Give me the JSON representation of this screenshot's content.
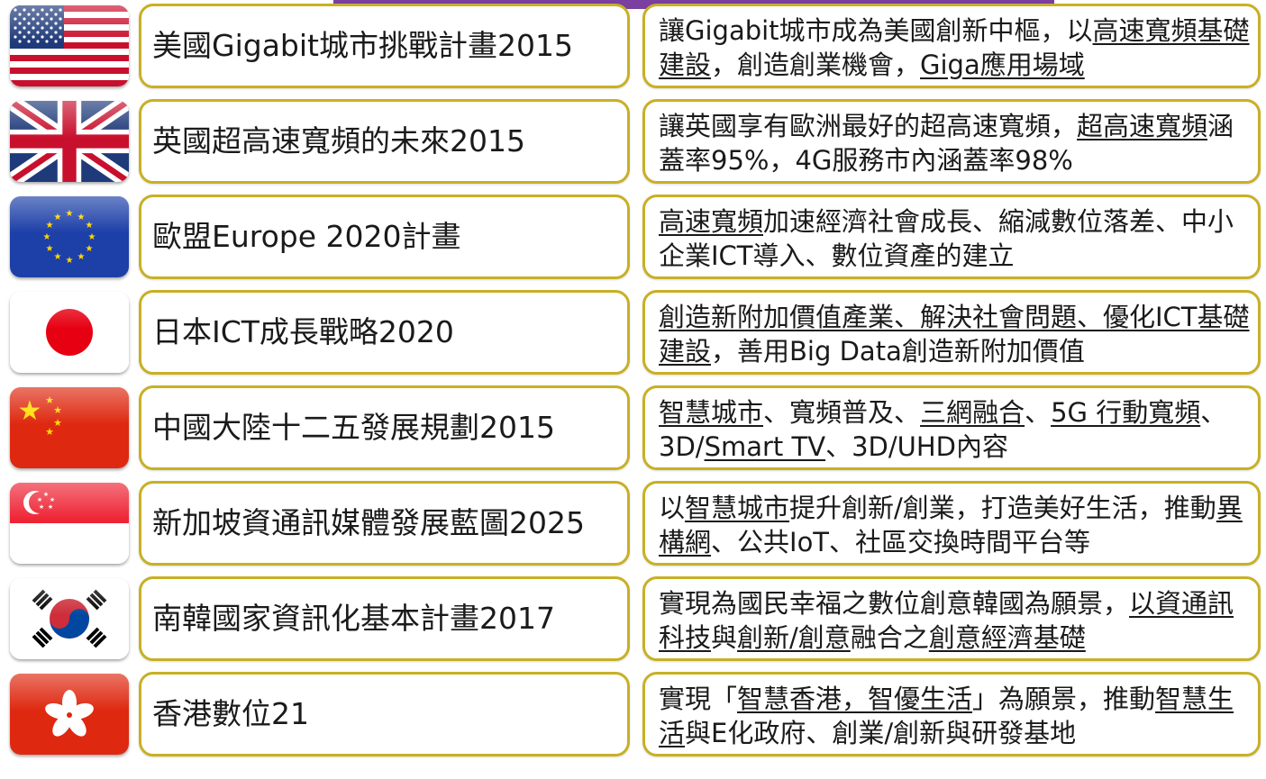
{
  "rows": [
    {
      "flag": "flag-usa",
      "name": "美國Gigabit城市挑戰計畫2015",
      "desc": [
        {
          "t": "讓Gigabit城市成為美國創新中樞，以",
          "u": false
        },
        {
          "t": "高速寬頻基礎建設",
          "u": true
        },
        {
          "t": "，創造創業機會，",
          "u": false
        },
        {
          "t": "Giga應用場域",
          "u": true
        }
      ]
    },
    {
      "flag": "flag-uk",
      "name": "英國超高速寬頻的未來2015",
      "desc": [
        {
          "t": "讓英國享有歐洲最好的超高速寬頻，",
          "u": false
        },
        {
          "t": "超高速寬頻",
          "u": true
        },
        {
          "t": "涵蓋率95%，4G服務市內涵蓋率98%",
          "u": false
        }
      ]
    },
    {
      "flag": "flag-eu",
      "name": "歐盟Europe 2020計畫",
      "desc": [
        {
          "t": "高速寬頻",
          "u": true
        },
        {
          "t": "加速經濟社會成長、縮減數位落差、中小企業ICT導入、數位資產的建立",
          "u": false
        }
      ]
    },
    {
      "flag": "flag-japan",
      "name": "日本ICT成長戰略2020",
      "desc": [
        {
          "t": "創造新附加價值產業、解決社會問題、優化ICT基礎建設",
          "u": true
        },
        {
          "t": "，善用Big Data創造新附加價值",
          "u": false
        }
      ]
    },
    {
      "flag": "flag-china",
      "name": "中國大陸十二五發展規劃2015",
      "desc": [
        {
          "t": "智慧城市",
          "u": true
        },
        {
          "t": "、",
          "u": false
        },
        {
          "t": "寬頻普及",
          "u": false
        },
        {
          "t": "、",
          "u": false
        },
        {
          "t": "三網融合",
          "u": true
        },
        {
          "t": "、",
          "u": false
        },
        {
          "t": "5G 行動寬頻",
          "u": true
        },
        {
          "t": "、3D/",
          "u": false
        },
        {
          "t": "Smart TV",
          "u": true
        },
        {
          "t": "、3D/UHD內容",
          "u": false
        }
      ]
    },
    {
      "flag": "flag-singapore",
      "name": "新加坡資通訊媒體發展藍圖2025",
      "desc": [
        {
          "t": "以",
          "u": false
        },
        {
          "t": "智慧城市",
          "u": true
        },
        {
          "t": "提升創新/創業，打造美好生活，推動",
          "u": false
        },
        {
          "t": "異構網",
          "u": true
        },
        {
          "t": "、公共IoT、社區交換時間平台等",
          "u": false
        }
      ]
    },
    {
      "flag": "flag-korea",
      "name": "南韓國家資訊化基本計畫2017",
      "desc": [
        {
          "t": "實現為國民幸福之數位創意韓國為願景，",
          "u": false
        },
        {
          "t": "以資通訊科技",
          "u": true
        },
        {
          "t": "與",
          "u": false
        },
        {
          "t": "創新/創意",
          "u": true
        },
        {
          "t": "融合之",
          "u": false
        },
        {
          "t": "創意經濟基礎",
          "u": true
        }
      ]
    },
    {
      "flag": "flag-hongkong",
      "name": "香港數位21",
      "desc": [
        {
          "t": "實現「",
          "u": false
        },
        {
          "t": "智慧香港，智優生活",
          "u": true
        },
        {
          "t": "」為願景，推動",
          "u": false
        },
        {
          "t": "智慧生活",
          "u": true
        },
        {
          "t": "與E化政府、創業/創新與研發基地",
          "u": false
        }
      ]
    }
  ]
}
